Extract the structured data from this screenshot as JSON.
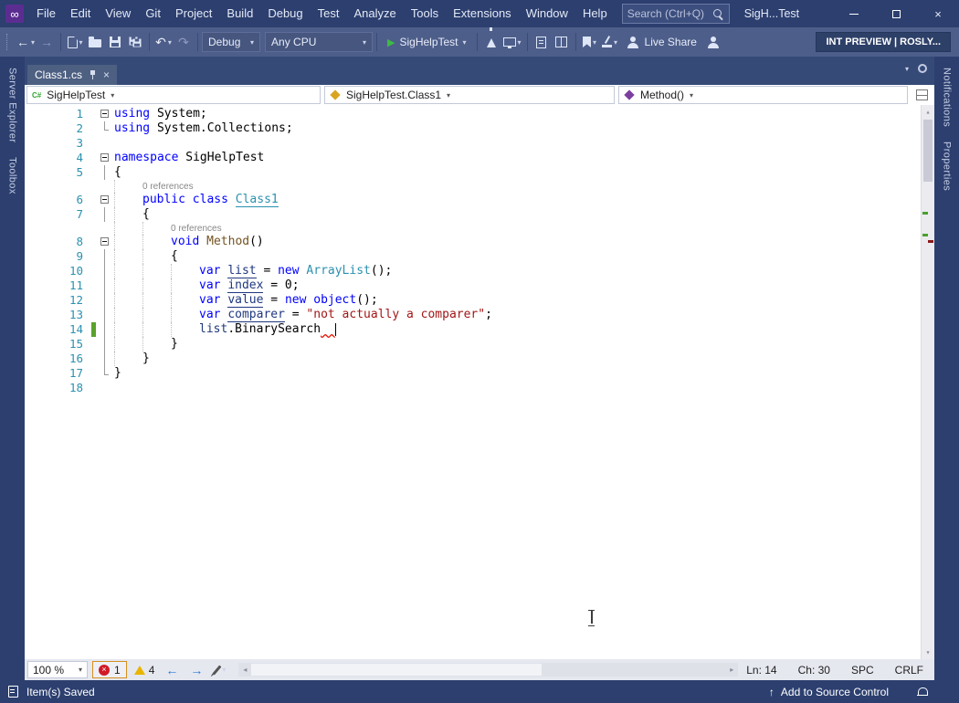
{
  "icons": {
    "infinity": "∞",
    "back_arrow": "←",
    "forward_arrow": "→",
    "undo_arrow": "↶",
    "redo_arrow": "↷",
    "chevron_down": "▾",
    "play": "▶",
    "close_x": "×",
    "error_x": "×",
    "csharp": "C#",
    "scroll_up": "▴",
    "scroll_down": "▾",
    "scroll_left": "◂",
    "scroll_right": "▸",
    "prev_arrow": "←",
    "next_arrow": "→",
    "up_arrow": "↑"
  },
  "titlebar": {
    "menu_items": [
      "File",
      "Edit",
      "View",
      "Git",
      "Project",
      "Build",
      "Debug",
      "Test",
      "Analyze",
      "Tools",
      "Extensions",
      "Window",
      "Help"
    ],
    "search_placeholder": "Search (Ctrl+Q)",
    "window_title": "SigH...Test"
  },
  "toolbar": {
    "config": "Debug",
    "platform": "Any CPU",
    "startup_project": "SigHelpTest",
    "live_share_label": "Live Share",
    "preview_badge": "INT PREVIEW | ROSLY..."
  },
  "left_dock": {
    "tabs": [
      "Server Explorer",
      "Toolbox"
    ]
  },
  "right_dock": {
    "tabs": [
      "Notifications",
      "Properties"
    ]
  },
  "document": {
    "tab_label": "Class1.cs",
    "navbar": {
      "project": "SigHelpTest",
      "type": "SigHelpTest.Class1",
      "member": "Method()"
    }
  },
  "editor": {
    "codelens_label": "0 references",
    "lines": [
      {
        "n": "1",
        "ind": 0,
        "fold": "box",
        "tokens": [
          [
            "k",
            "using"
          ],
          [
            "p",
            " System;"
          ]
        ]
      },
      {
        "n": "2",
        "ind": 0,
        "fold": "line-end",
        "tokens": [
          [
            "k",
            "using"
          ],
          [
            "p",
            " System.Collections;"
          ]
        ]
      },
      {
        "n": "3",
        "ind": 0,
        "tokens": []
      },
      {
        "n": "4",
        "ind": 0,
        "fold": "box",
        "tokens": [
          [
            "k",
            "namespace"
          ],
          [
            "p",
            " SigHelpTest"
          ]
        ]
      },
      {
        "n": "5",
        "ind": 0,
        "fold": "line",
        "tokens": [
          [
            "p",
            "{"
          ]
        ]
      },
      {
        "lens": true,
        "ind": 1
      },
      {
        "n": "6",
        "ind": 1,
        "fold": "box",
        "tokens": [
          [
            "k",
            "public"
          ],
          [
            "p",
            " "
          ],
          [
            "k",
            "class"
          ],
          [
            "p",
            " "
          ],
          [
            "tu",
            "Class1"
          ]
        ]
      },
      {
        "n": "7",
        "ind": 1,
        "fold": "line",
        "tokens": [
          [
            "p",
            "{"
          ]
        ]
      },
      {
        "lens": true,
        "ind": 2
      },
      {
        "n": "8",
        "ind": 2,
        "fold": "box",
        "tokens": [
          [
            "k",
            "void"
          ],
          [
            "p",
            " "
          ],
          [
            "m",
            "Method"
          ],
          [
            "p",
            "()"
          ]
        ]
      },
      {
        "n": "9",
        "ind": 2,
        "fold": "line",
        "tokens": [
          [
            "p",
            "{"
          ]
        ]
      },
      {
        "n": "10",
        "ind": 3,
        "fold": "line",
        "tokens": [
          [
            "k",
            "var"
          ],
          [
            "p",
            " "
          ],
          [
            "vu",
            "list"
          ],
          [
            "p",
            " = "
          ],
          [
            "k",
            "new"
          ],
          [
            "p",
            " "
          ],
          [
            "t",
            "ArrayList"
          ],
          [
            "p",
            "();"
          ]
        ]
      },
      {
        "n": "11",
        "ind": 3,
        "fold": "line",
        "tokens": [
          [
            "k",
            "var"
          ],
          [
            "p",
            " "
          ],
          [
            "vu",
            "index"
          ],
          [
            "p",
            " = 0;"
          ]
        ]
      },
      {
        "n": "12",
        "ind": 3,
        "fold": "line",
        "tokens": [
          [
            "k",
            "var"
          ],
          [
            "p",
            " "
          ],
          [
            "vu",
            "value"
          ],
          [
            "p",
            " = "
          ],
          [
            "k",
            "new"
          ],
          [
            "p",
            " "
          ],
          [
            "k",
            "object"
          ],
          [
            "p",
            "();"
          ]
        ]
      },
      {
        "n": "13",
        "ind": 3,
        "fold": "line",
        "tokens": [
          [
            "k",
            "var"
          ],
          [
            "p",
            " "
          ],
          [
            "vu",
            "comparer"
          ],
          [
            "p",
            " = "
          ],
          [
            "s",
            "\"not actually a comparer\""
          ],
          [
            "p",
            ";"
          ]
        ]
      },
      {
        "n": "14",
        "ind": 3,
        "fold": "line",
        "change": true,
        "caret": true,
        "tokens": [
          [
            "v",
            "list"
          ],
          [
            "p",
            "."
          ],
          [
            "p",
            "BinarySearch"
          ],
          [
            "sq",
            "  "
          ]
        ]
      },
      {
        "n": "15",
        "ind": 2,
        "fold": "line",
        "tokens": [
          [
            "p",
            "}"
          ]
        ]
      },
      {
        "n": "16",
        "ind": 1,
        "fold": "line",
        "tokens": [
          [
            "p",
            "}"
          ]
        ]
      },
      {
        "n": "17",
        "ind": 0,
        "fold": "line-end",
        "tokens": [
          [
            "p",
            "}"
          ]
        ]
      },
      {
        "n": "18",
        "ind": 0,
        "tokens": []
      }
    ]
  },
  "editor_bar": {
    "zoom": "100 %",
    "error_count": "1",
    "warning_count": "4",
    "line": "Ln: 14",
    "column": "Ch: 30",
    "spaces": "SPC",
    "line_ending": "CRLF"
  },
  "statusbar": {
    "message": "Item(s) Saved",
    "source_control": "Add to Source Control"
  }
}
